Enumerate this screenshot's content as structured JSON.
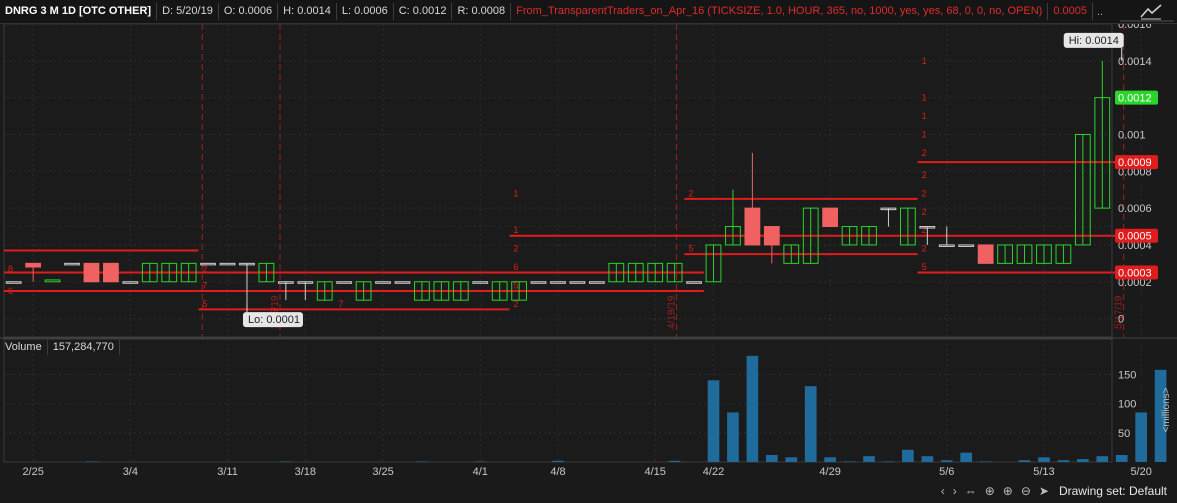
{
  "header": {
    "symbol": "DNRG 3 M 1D [OTC OTHER]",
    "date": "D: 5/20/19",
    "open": "O: 0.0006",
    "high": "H: 0.0014",
    "low": "L: 0.0006",
    "close": "C: 0.0012",
    "range": "R: 0.0008",
    "study": "From_TransparentTraders_on_Apr_16 (TICKSIZE, 1.0, HOUR, 365, no, 1000, yes, yes, 68, 0, 0, no, OPEN)",
    "study_value": "0.0005",
    "more": ".."
  },
  "volume_header": {
    "label": "Volume",
    "value": "157,284,770"
  },
  "bottom": {
    "drawing_set": "Drawing set: Default"
  },
  "colors": {
    "up": "#2bd42b",
    "down": "#f06262",
    "level": "#e01c1c",
    "volume": "#1f6b9c"
  },
  "chart_data": [
    {
      "type": "candlestick",
      "price_axis_ticks": [
        0,
        0.0002,
        0.0004,
        0.0005,
        0.0006,
        0.0008,
        0.001,
        0.0012,
        0.0014,
        0.0016
      ],
      "price_axis_labels": [
        "0",
        "0.0002",
        "0.0004",
        "",
        "0.0006",
        "0.0008",
        "0.001",
        "",
        "0.0014",
        "0.0016"
      ],
      "ylim": [
        -0.0001,
        0.0016
      ],
      "x_tick_labels": [
        {
          "i": 1,
          "label": "2/25"
        },
        {
          "i": 6,
          "label": "3/4"
        },
        {
          "i": 11,
          "label": "3/11"
        },
        {
          "i": 15,
          "label": "3/18"
        },
        {
          "i": 19,
          "label": "3/25"
        },
        {
          "i": 24,
          "label": "4/1"
        },
        {
          "i": 28,
          "label": "4/8"
        },
        {
          "i": 33,
          "label": "4/15"
        },
        {
          "i": 36,
          "label": "4/22"
        },
        {
          "i": 42,
          "label": "4/29"
        },
        {
          "i": 48,
          "label": "5/6"
        },
        {
          "i": 53,
          "label": "5/13"
        },
        {
          "i": 58,
          "label": "5/20"
        }
      ],
      "candles": [
        {
          "o": 0.0002,
          "h": 0.0002,
          "l": 0.0002,
          "c": 0.0002
        },
        {
          "o": 0.0003,
          "h": 0.0003,
          "l": 0.0002,
          "c": 0.00028
        },
        {
          "o": 0.0002,
          "h": 0.0002,
          "l": 0.0002,
          "c": 0.00021
        },
        {
          "o": 0.0003,
          "h": 0.0003,
          "l": 0.0003,
          "c": 0.0003
        },
        {
          "o": 0.0003,
          "h": 0.0003,
          "l": 0.0002,
          "c": 0.0002
        },
        {
          "o": 0.0003,
          "h": 0.0003,
          "l": 0.0002,
          "c": 0.0002
        },
        {
          "o": 0.0002,
          "h": 0.0002,
          "l": 0.0002,
          "c": 0.0002
        },
        {
          "o": 0.0002,
          "h": 0.0003,
          "l": 0.0002,
          "c": 0.0003
        },
        {
          "o": 0.0002,
          "h": 0.0003,
          "l": 0.0002,
          "c": 0.0003
        },
        {
          "o": 0.0002,
          "h": 0.0003,
          "l": 0.0002,
          "c": 0.0003
        },
        {
          "o": 0.0003,
          "h": 0.0003,
          "l": 0.0003,
          "c": 0.0003
        },
        {
          "o": 0.0003,
          "h": 0.0003,
          "l": 0.0003,
          "c": 0.0003
        },
        {
          "o": 0.0003,
          "h": 0.0003,
          "l": 0.0001,
          "c": 0.0003
        },
        {
          "o": 0.0002,
          "h": 0.0003,
          "l": 0.0002,
          "c": 0.0003
        },
        {
          "o": 0.0002,
          "h": 0.0002,
          "l": 0.0001,
          "c": 0.0002
        },
        {
          "o": 0.0002,
          "h": 0.0002,
          "l": 0.0001,
          "c": 0.0002
        },
        {
          "o": 0.0001,
          "h": 0.0002,
          "l": 0.0001,
          "c": 0.0002
        },
        {
          "o": 0.0002,
          "h": 0.0002,
          "l": 0.0002,
          "c": 0.0002
        },
        {
          "o": 0.0001,
          "h": 0.0002,
          "l": 0.0001,
          "c": 0.0002
        },
        {
          "o": 0.0002,
          "h": 0.0002,
          "l": 0.0002,
          "c": 0.0002
        },
        {
          "o": 0.0002,
          "h": 0.0002,
          "l": 0.0002,
          "c": 0.0002
        },
        {
          "o": 0.0001,
          "h": 0.0002,
          "l": 0.0001,
          "c": 0.0002
        },
        {
          "o": 0.0001,
          "h": 0.0002,
          "l": 0.0001,
          "c": 0.0002
        },
        {
          "o": 0.0001,
          "h": 0.0002,
          "l": 0.0001,
          "c": 0.0002
        },
        {
          "o": 0.0002,
          "h": 0.0002,
          "l": 0.0002,
          "c": 0.0002
        },
        {
          "o": 0.0001,
          "h": 0.0002,
          "l": 0.0001,
          "c": 0.0002
        },
        {
          "o": 0.0001,
          "h": 0.0002,
          "l": 0.0001,
          "c": 0.0002
        },
        {
          "o": 0.0002,
          "h": 0.0002,
          "l": 0.0002,
          "c": 0.0002
        },
        {
          "o": 0.0002,
          "h": 0.0002,
          "l": 0.0002,
          "c": 0.0002
        },
        {
          "o": 0.0002,
          "h": 0.0002,
          "l": 0.0002,
          "c": 0.0002
        },
        {
          "o": 0.0002,
          "h": 0.0002,
          "l": 0.0002,
          "c": 0.0002
        },
        {
          "o": 0.0002,
          "h": 0.0003,
          "l": 0.0002,
          "c": 0.0003
        },
        {
          "o": 0.0002,
          "h": 0.0003,
          "l": 0.0002,
          "c": 0.0003
        },
        {
          "o": 0.0002,
          "h": 0.0003,
          "l": 0.0002,
          "c": 0.0003
        },
        {
          "o": 0.0002,
          "h": 0.0003,
          "l": 0.0002,
          "c": 0.0003
        },
        {
          "o": 0.0002,
          "h": 0.0002,
          "l": 0.0002,
          "c": 0.0002
        },
        {
          "o": 0.0002,
          "h": 0.0004,
          "l": 0.0002,
          "c": 0.0004
        },
        {
          "o": 0.0004,
          "h": 0.0007,
          "l": 0.0004,
          "c": 0.0005
        },
        {
          "o": 0.0006,
          "h": 0.0009,
          "l": 0.0004,
          "c": 0.0004
        },
        {
          "o": 0.0005,
          "h": 0.0005,
          "l": 0.0003,
          "c": 0.0004
        },
        {
          "o": 0.0003,
          "h": 0.0004,
          "l": 0.0003,
          "c": 0.0004
        },
        {
          "o": 0.0003,
          "h": 0.0006,
          "l": 0.0003,
          "c": 0.0006
        },
        {
          "o": 0.0006,
          "h": 0.0006,
          "l": 0.0005,
          "c": 0.0005
        },
        {
          "o": 0.0004,
          "h": 0.0005,
          "l": 0.0004,
          "c": 0.0005
        },
        {
          "o": 0.0004,
          "h": 0.0005,
          "l": 0.0004,
          "c": 0.0005
        },
        {
          "o": 0.0006,
          "h": 0.0006,
          "l": 0.0005,
          "c": 0.0006
        },
        {
          "o": 0.0004,
          "h": 0.0006,
          "l": 0.0004,
          "c": 0.0006
        },
        {
          "o": 0.0005,
          "h": 0.0005,
          "l": 0.0004,
          "c": 0.0005
        },
        {
          "o": 0.0004,
          "h": 0.0005,
          "l": 0.0004,
          "c": 0.0004
        },
        {
          "o": 0.0004,
          "h": 0.0004,
          "l": 0.0004,
          "c": 0.0004
        },
        {
          "o": 0.0004,
          "h": 0.0004,
          "l": 0.0003,
          "c": 0.0003
        },
        {
          "o": 0.0003,
          "h": 0.0004,
          "l": 0.0003,
          "c": 0.0004
        },
        {
          "o": 0.0003,
          "h": 0.0004,
          "l": 0.0003,
          "c": 0.0004
        },
        {
          "o": 0.0003,
          "h": 0.0004,
          "l": 0.0003,
          "c": 0.0004
        },
        {
          "o": 0.0003,
          "h": 0.0004,
          "l": 0.0003,
          "c": 0.0004
        },
        {
          "o": 0.0004,
          "h": 0.001,
          "l": 0.0004,
          "c": 0.001
        },
        {
          "o": 0.0006,
          "h": 0.0014,
          "l": 0.0006,
          "c": 0.0012
        }
      ],
      "levels": [
        {
          "y": 0.00037,
          "i0": 0,
          "i1": 10
        },
        {
          "y": 0.00025,
          "i0": 0,
          "i1": 10
        },
        {
          "y": 0.00015,
          "i0": 0,
          "i1": 10
        },
        {
          "y": 0.00025,
          "i0": 10,
          "i1": 36
        },
        {
          "y": 0.00015,
          "i0": 10,
          "i1": 36
        },
        {
          "y": 5e-05,
          "i0": 10,
          "i1": 26
        },
        {
          "y": 0.00045,
          "i0": 26,
          "i1": 59
        },
        {
          "y": 0.00065,
          "i0": 35,
          "i1": 47
        },
        {
          "y": 0.00035,
          "i0": 35,
          "i1": 47
        },
        {
          "y": 0.00085,
          "i0": 47,
          "i1": 59
        },
        {
          "y": 0.00025,
          "i0": 47,
          "i1": 59
        }
      ],
      "level_annotations": [
        {
          "i": 0,
          "y": 0.00027,
          "t": "8"
        },
        {
          "i": 0,
          "y": 0.00015,
          "t": "6"
        },
        {
          "i": 10,
          "y": 0.00027,
          "t": "2"
        },
        {
          "i": 10,
          "y": 0.00018,
          "t": "7"
        },
        {
          "i": 10,
          "y": 8e-05,
          "t": "5"
        },
        {
          "i": 17,
          "y": 8e-05,
          "t": "7"
        },
        {
          "i": 26,
          "y": 0.00068,
          "t": "1"
        },
        {
          "i": 26,
          "y": 0.00048,
          "t": "1"
        },
        {
          "i": 26,
          "y": 0.00038,
          "t": "2"
        },
        {
          "i": 26,
          "y": 0.00028,
          "t": "6"
        },
        {
          "i": 26,
          "y": 0.00018,
          "t": "5"
        },
        {
          "i": 26,
          "y": 8e-05,
          "t": "2"
        },
        {
          "i": 35,
          "y": 0.00068,
          "t": "2"
        },
        {
          "i": 35,
          "y": 0.00038,
          "t": "5"
        },
        {
          "i": 47,
          "y": 0.0014,
          "t": "1"
        },
        {
          "i": 47,
          "y": 0.0012,
          "t": "1"
        },
        {
          "i": 47,
          "y": 0.0011,
          "t": "1"
        },
        {
          "i": 47,
          "y": 0.001,
          "t": "1"
        },
        {
          "i": 47,
          "y": 0.0009,
          "t": "2"
        },
        {
          "i": 47,
          "y": 0.00078,
          "t": "2"
        },
        {
          "i": 47,
          "y": 0.00068,
          "t": "2"
        },
        {
          "i": 47,
          "y": 0.00058,
          "t": "2"
        },
        {
          "i": 47,
          "y": 0.00048,
          "t": "2"
        },
        {
          "i": 47,
          "y": 0.00038,
          "t": "2"
        },
        {
          "i": 47,
          "y": 0.00028,
          "t": "5"
        }
      ],
      "vertical_markers": [
        {
          "i": 10.2,
          "label": ""
        },
        {
          "i": 14.2,
          "label": "3/15/19"
        },
        {
          "i": 34.6,
          "label": "4/19/19"
        },
        {
          "i": 57.6,
          "label": "5/17/19"
        }
      ],
      "price_bubbles": [
        {
          "value": "0.0012",
          "y": 0.0012,
          "color": "#2bd42b"
        },
        {
          "value": "0.0009",
          "y": 0.00085,
          "color": "#e01c1c"
        },
        {
          "value": "0.0005",
          "y": 0.00045,
          "color": "#e01c1c"
        },
        {
          "value": "0.0003",
          "y": 0.00025,
          "color": "#e01c1c"
        }
      ],
      "callouts": [
        {
          "i": 57,
          "y": 0.0014,
          "text": "Hi: 0.0014"
        },
        {
          "i": 12,
          "y": 0.0001,
          "text": "Lo: 0.0001"
        }
      ]
    },
    {
      "type": "bar",
      "title": "Volume",
      "unit_label": "<millions>",
      "ylim": [
        0,
        180
      ],
      "y_ticks": [
        50,
        100,
        150
      ],
      "values": [
        0,
        0,
        0,
        0,
        1,
        0,
        0,
        0,
        0,
        0,
        0,
        0,
        0,
        0,
        1,
        0,
        0,
        0,
        0,
        0,
        0,
        1,
        0,
        0,
        1,
        0,
        0,
        0,
        2,
        0,
        0,
        0,
        0,
        0,
        2,
        0,
        140,
        85,
        182,
        12,
        8,
        130,
        8,
        1,
        10,
        1,
        21,
        10,
        3,
        16,
        1,
        0,
        3,
        8,
        3,
        5,
        10,
        12,
        85,
        158
      ]
    }
  ]
}
